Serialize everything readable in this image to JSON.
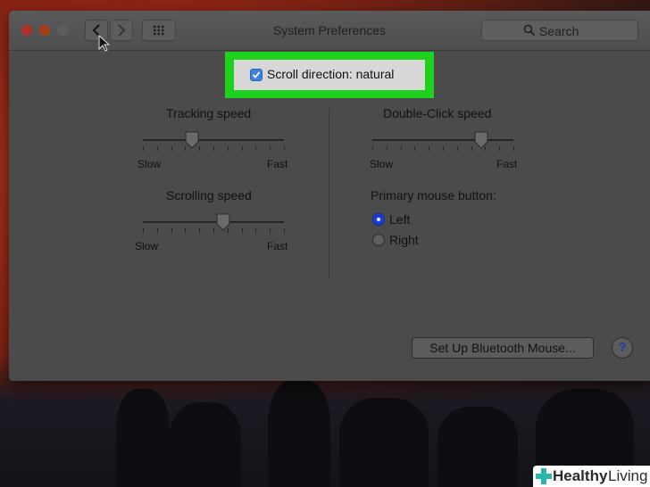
{
  "window": {
    "title": "System Preferences",
    "search_placeholder": "Search"
  },
  "scroll_direction": {
    "label": "Scroll direction: natural",
    "checked": true,
    "highlight_color": "#1fd11f"
  },
  "tracking_speed": {
    "label": "Tracking speed",
    "min_label": "Slow",
    "max_label": "Fast",
    "value": 0.35
  },
  "scrolling_speed": {
    "label": "Scrolling speed",
    "min_label": "Slow",
    "max_label": "Fast",
    "value": 0.57
  },
  "double_click_speed": {
    "label": "Double-Click speed",
    "min_label": "Slow",
    "max_label": "Fast",
    "value": 0.77
  },
  "primary_button": {
    "label": "Primary mouse button:",
    "options": [
      {
        "label": "Left",
        "selected": true
      },
      {
        "label": "Right",
        "selected": false
      }
    ]
  },
  "bluetooth_button": "Set Up Bluetooth Mouse...",
  "help_label": "?",
  "watermark": {
    "bold": "Healthy",
    "regular": "Living",
    "plus_color": "#2bb5a8"
  }
}
